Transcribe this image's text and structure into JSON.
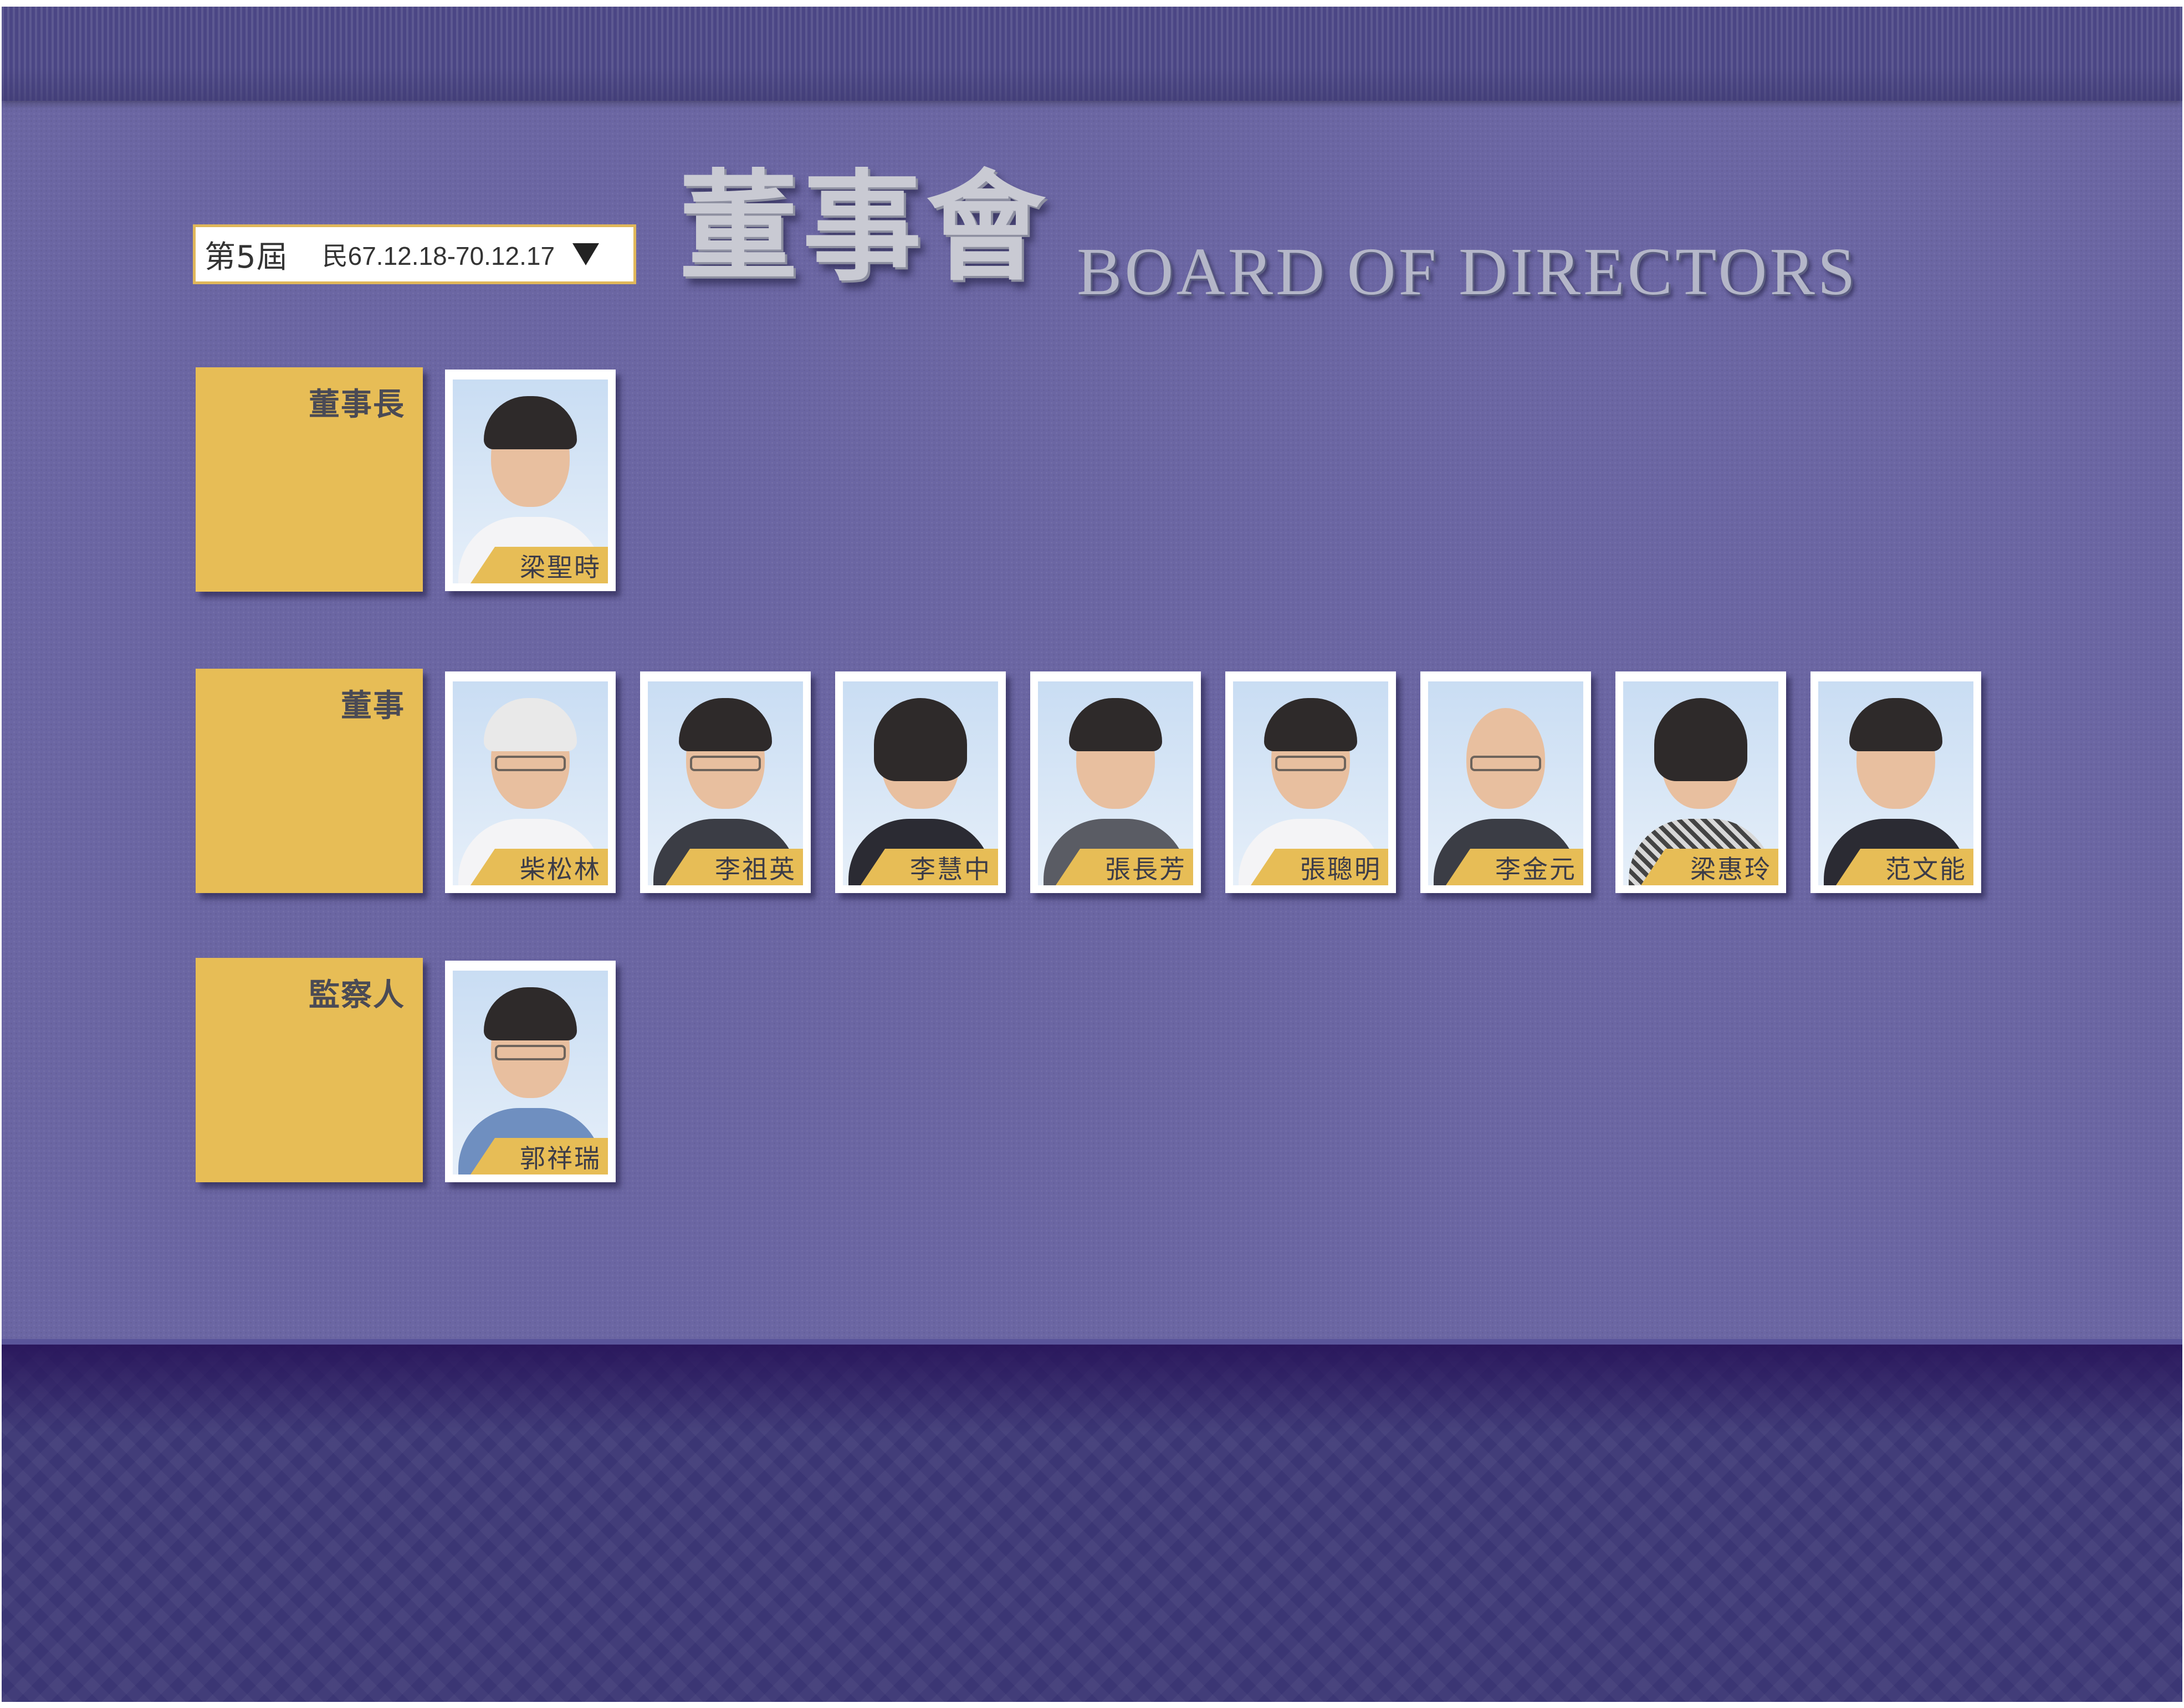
{
  "term_selector": {
    "term": "第5屆",
    "dates": "民67.12.18-70.12.17",
    "arrow_icon": "triangle-down-icon"
  },
  "title": {
    "zh": "董事會",
    "en": "BOARD OF DIRECTORS"
  },
  "roles": {
    "chairman": {
      "label": "董事長",
      "members": [
        "梁聖時"
      ]
    },
    "directors": {
      "label": "董事",
      "members": [
        "柴松林",
        "李祖英",
        "李慧中",
        "張長芳",
        "張聰明",
        "李金元",
        "梁惠玲",
        "范文能"
      ]
    },
    "supervisor": {
      "label": "監察人",
      "members": [
        "郭祥瑞"
      ]
    }
  },
  "colors": {
    "background": "#6b66a3",
    "accent_gold": "#e7bd56",
    "header_band": "#4b4685",
    "footer_band": "#3b3674"
  }
}
